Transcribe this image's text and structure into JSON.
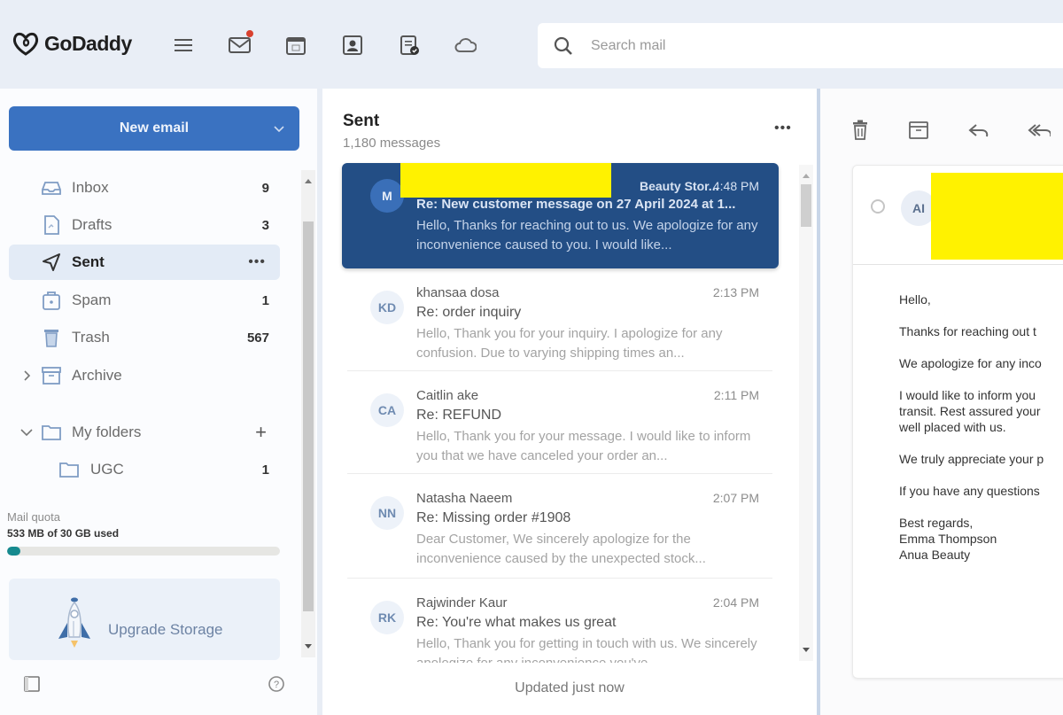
{
  "header": {
    "brand": "GoDaddy",
    "icons": [
      "menu-icon",
      "mail-icon",
      "calendar-icon",
      "contacts-icon",
      "tasks-icon",
      "cloud-icon"
    ],
    "mail_has_notification": true,
    "search_placeholder": "Search mail"
  },
  "sidebar": {
    "new_email_label": "New email",
    "folders": [
      {
        "label": "Inbox",
        "count": "9",
        "icon": "inbox-icon"
      },
      {
        "label": "Drafts",
        "count": "3",
        "icon": "drafts-icon"
      },
      {
        "label": "Sent",
        "more": "•••",
        "icon": "sent-icon",
        "active": true
      },
      {
        "label": "Spam",
        "count": "1",
        "icon": "spam-icon"
      },
      {
        "label": "Trash",
        "count": "567",
        "icon": "trash-icon"
      },
      {
        "label": "Archive",
        "icon": "archive-icon",
        "collapsed": true
      }
    ],
    "my_folders": {
      "label": "My folders",
      "add": "+",
      "children": [
        {
          "label": "UGC",
          "count": "1"
        }
      ]
    },
    "quota": {
      "title": "Mail quota",
      "used_text": "533 MB of 30 GB used",
      "used_fraction": 0.018
    },
    "upgrade_label": "Upgrade Storage"
  },
  "message_list": {
    "folder_title": "Sent",
    "message_count": "1,180 messages",
    "more": "•••",
    "messages": [
      {
        "initials": "M",
        "sender": "Beauty Stor...",
        "time": "4:48 PM",
        "subject": "Re: New customer message on 27 April 2024 at 1...",
        "preview": "Hello, Thanks for reaching out to us. We apologize for any inconvenience caused to you. I would like...",
        "selected": true
      },
      {
        "initials": "KD",
        "sender": "khansaa dosa",
        "time": "2:13 PM",
        "subject": "Re: order inquiry",
        "preview": "Hello, Thank you for your inquiry. I apologize for any confusion. Due to varying shipping times an..."
      },
      {
        "initials": "CA",
        "sender": "Caitlin ake",
        "time": "2:11 PM",
        "subject": "Re: REFUND",
        "preview": "Hello, Thank you for your message. I would like to inform you that we have canceled your order an..."
      },
      {
        "initials": "NN",
        "sender": "Natasha Naeem",
        "time": "2:07 PM",
        "subject": "Re: Missing order #1908",
        "preview": "Dear Customer, We sincerely apologize for the inconvenience caused by the unexpected stock..."
      },
      {
        "initials": "RK",
        "sender": "Rajwinder Kaur",
        "time": "2:04 PM",
        "subject": "Re: You're what makes us great",
        "preview": "Hello, Thank you for getting in touch with us. We sincerely apologize for any inconvenience you've..."
      }
    ],
    "updated_text": "Updated just now"
  },
  "reading_pane": {
    "toolbar": [
      "delete-icon",
      "archive-icon",
      "reply-icon",
      "reply-all-icon"
    ],
    "avatar_initials": "AI",
    "body": [
      "Hello,",
      "Thanks for reaching out t",
      "We apologize for any inco",
      "I would like to inform you\ntransit. Rest assured your\nwell placed with us.",
      "We truly appreciate your p",
      "If you have any questions",
      "Best regards,\nEmma Thompson\nAnua Beauty"
    ]
  },
  "colors": {
    "accent": "#3a72c1",
    "selected_row": "#234e85",
    "quota_fill": "#168a8f",
    "notification": "#d9412f",
    "redaction": "#fff200"
  }
}
